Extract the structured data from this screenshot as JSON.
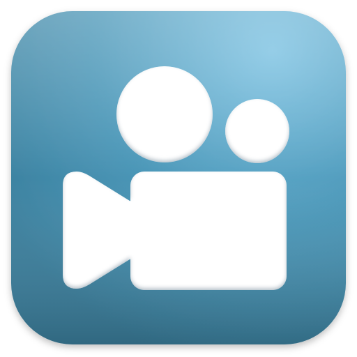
{
  "icon": {
    "name": "video-camera-icon",
    "colors": {
      "background": "#ffffff",
      "tile_base": "#4b97b8",
      "tile_highlight": "#7cc2e2",
      "tile_shadow": "#3a7f9d",
      "glyph": "#ffffff"
    }
  }
}
